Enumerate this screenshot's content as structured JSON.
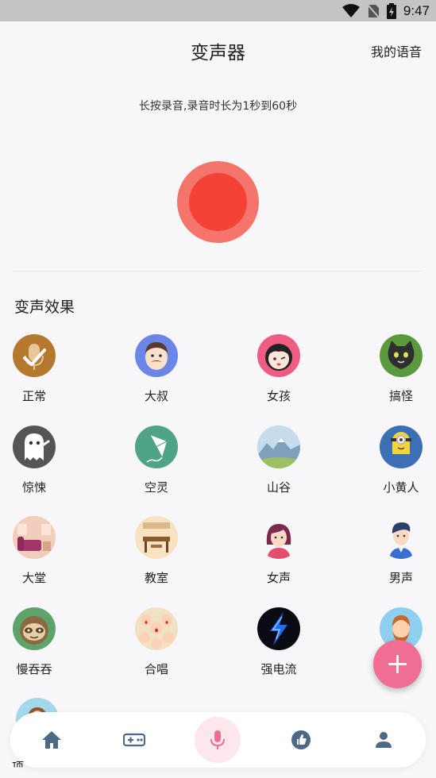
{
  "status_bar": {
    "time": "9:47"
  },
  "header": {
    "title": "变声器",
    "my_voice": "我的语音"
  },
  "record": {
    "hint": "长按录音,录音时长为1秒到60秒"
  },
  "effects_section": {
    "title": "变声效果",
    "items": [
      {
        "label": "正常",
        "icon": "microphone-check-icon"
      },
      {
        "label": "大叔",
        "icon": "uncle-face-icon"
      },
      {
        "label": "女孩",
        "icon": "girl-face-icon"
      },
      {
        "label": "搞怪",
        "icon": "cat-face-icon"
      },
      {
        "label": "惊悚",
        "icon": "ghost-icon"
      },
      {
        "label": "空灵",
        "icon": "kite-icon"
      },
      {
        "label": "山谷",
        "icon": "mountain-valley-icon"
      },
      {
        "label": "小黄人",
        "icon": "minion-icon"
      },
      {
        "label": "大堂",
        "icon": "lobby-icon"
      },
      {
        "label": "教室",
        "icon": "classroom-icon"
      },
      {
        "label": "女声",
        "icon": "woman-icon"
      },
      {
        "label": "男声",
        "icon": "man-icon"
      },
      {
        "label": "慢吞吞",
        "icon": "sloth-icon"
      },
      {
        "label": "合唱",
        "icon": "chorus-icon"
      },
      {
        "label": "强电流",
        "icon": "lightning-icon"
      },
      {
        "label": "",
        "icon": "bearded-man-icon"
      },
      {
        "label": "",
        "icon": "jesus-icon"
      }
    ]
  },
  "partial_label": "项",
  "bottom_nav": [
    {
      "name": "home",
      "icon": "home-icon"
    },
    {
      "name": "games",
      "icon": "gamepad-icon"
    },
    {
      "name": "record",
      "icon": "microphone-icon"
    },
    {
      "name": "like",
      "icon": "thumbs-up-icon"
    },
    {
      "name": "profile",
      "icon": "person-icon"
    }
  ],
  "colors": {
    "record_outer": "#f5746b",
    "record_inner": "#f44336",
    "fab": "#f06e94",
    "nav_icon": "#4c6a86",
    "nav_active": "#f06e94"
  }
}
